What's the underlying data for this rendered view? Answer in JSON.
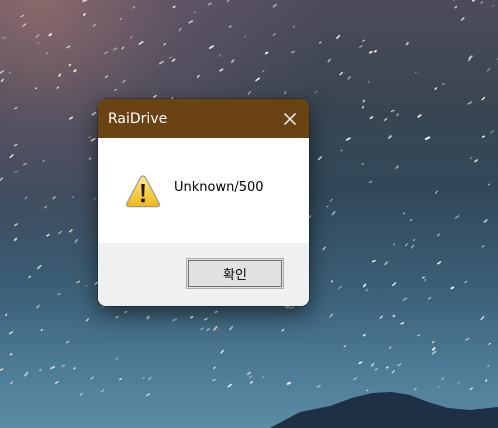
{
  "dialog": {
    "title": "RaiDrive",
    "message": "Unknown/500",
    "ok_label": "확인",
    "close_icon": "close-icon",
    "message_icon": "warning-icon"
  },
  "colors": {
    "titlebar": "#6a4214",
    "content_background": "#ffffff",
    "footer_background": "#f0f0f0"
  }
}
